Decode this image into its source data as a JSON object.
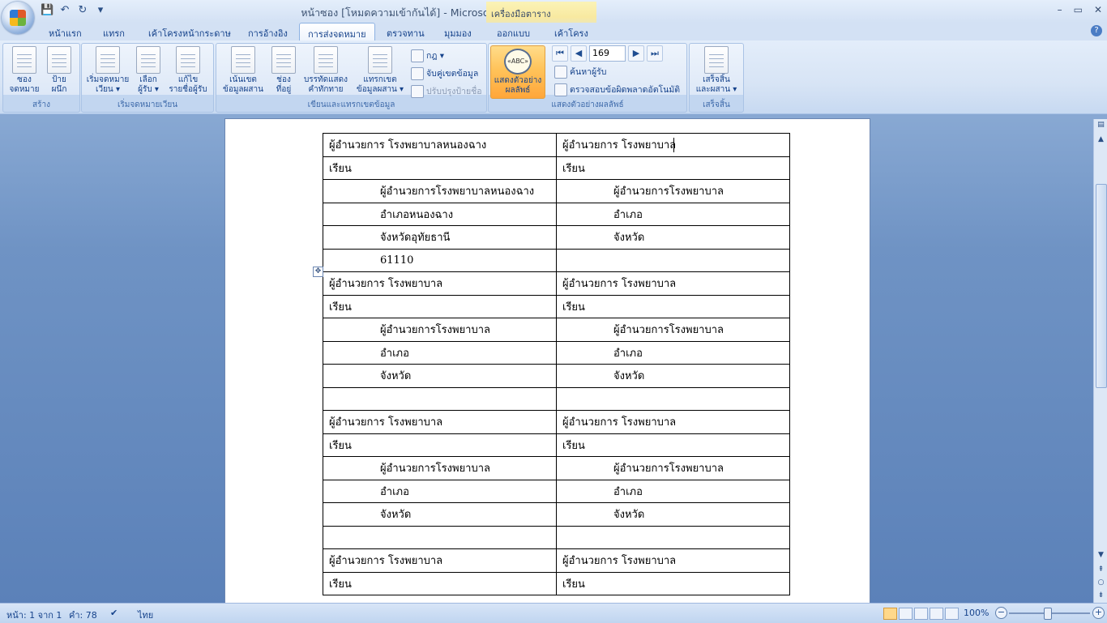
{
  "window": {
    "title": "หน้าซอง [โหมดความเข้ากันได้] - Microsoft Word",
    "context_tab": "เครื่องมือตาราง",
    "controls": [
      "–",
      "▭",
      "✕"
    ]
  },
  "qat": {
    "icons": [
      "save-icon",
      "undo-icon",
      "redo-icon",
      "customize-icon"
    ]
  },
  "tabs": [
    "หน้าแรก",
    "แทรก",
    "เค้าโครงหน้ากระดาษ",
    "การอ้างอิง",
    "การส่งจดหมาย",
    "ตรวจทาน",
    "มุมมอง",
    "ออกแบบ",
    "เค้าโครง"
  ],
  "active_tab": "การส่งจดหมาย",
  "ribbon": {
    "groups": [
      {
        "label": "สร้าง"
      },
      {
        "label": "เริ่มจดหมายเวียน"
      },
      {
        "label": "เขียนและแทรกเขตข้อมูล"
      },
      {
        "label": "แสดงตัวอย่างผลลัพธ์"
      },
      {
        "label": "เสร็จสิ้น"
      }
    ],
    "create": {
      "envelopes_1": "ซอง",
      "envelopes_2": "จดหมาย",
      "labels_1": "ป้าย",
      "labels_2": "ผนึก"
    },
    "start": {
      "start_merge_1": "เริ่มจดหมาย",
      "start_merge_2": "เวียน ▾",
      "select_1": "เลือก",
      "select_2": "ผู้รับ ▾",
      "edit_1": "แก้ไข",
      "edit_2": "รายชื่อผู้รับ"
    },
    "write": {
      "highlight_1": "เน้นเขต",
      "highlight_2": "ข้อมูลผสาน",
      "address_1": "ช่อง",
      "address_2": "ที่อยู่",
      "greeting_1": "บรรทัดแสดง",
      "greeting_2": "คำทักทาย",
      "insert_1": "แทรกเขต",
      "insert_2": "ข้อมูลผสาน ▾",
      "rules": "กฎ ▾",
      "match": "จับคู่เขตข้อมูล",
      "update": "ปรับปรุงป้ายชื่อ"
    },
    "preview": {
      "preview_1": "แสดงตัวอย่าง",
      "preview_2": "ผลลัพธ์",
      "record": "169",
      "find": "ค้นหาผู้รับ",
      "check": "ตรวจสอบข้อผิดพลาดอัตโนมัติ"
    },
    "finish": {
      "finish_1": "เสร็จสิ้น",
      "finish_2": "และผสาน ▾"
    }
  },
  "document": {
    "rows": [
      {
        "left": "ผู้อำนวยการ โรงพยาบาลหนองฉาง",
        "right": "ผู้อำนวยการ โรงพยาบาล",
        "indent": false
      },
      {
        "left": "เรียน",
        "right": "เรียน",
        "indent": false
      },
      {
        "left": "ผู้อำนวยการโรงพยาบาลหนองฉาง",
        "right": "ผู้อำนวยการโรงพยาบาล",
        "indent": true
      },
      {
        "left": "อำเภอหนองฉาง",
        "right": "อำเภอ",
        "indent": true
      },
      {
        "left": "จังหวัดอุทัยธานี",
        "right": "จังหวัด",
        "indent": true
      },
      {
        "left": "61110",
        "right": "",
        "indent": true
      },
      {
        "left": "ผู้อำนวยการ โรงพยาบาล",
        "right": "ผู้อำนวยการ โรงพยาบาล",
        "indent": false
      },
      {
        "left": "เรียน",
        "right": "เรียน",
        "indent": false
      },
      {
        "left": "ผู้อำนวยการโรงพยาบาล",
        "right": "ผู้อำนวยการโรงพยาบาล",
        "indent": true
      },
      {
        "left": "อำเภอ",
        "right": "อำเภอ",
        "indent": true
      },
      {
        "left": "จังหวัด",
        "right": "จังหวัด",
        "indent": true
      },
      {
        "left": "",
        "right": "",
        "indent": true
      },
      {
        "left": "ผู้อำนวยการ โรงพยาบาล",
        "right": "ผู้อำนวยการ โรงพยาบาล",
        "indent": false
      },
      {
        "left": "เรียน",
        "right": "เรียน",
        "indent": false
      },
      {
        "left": "ผู้อำนวยการโรงพยาบาล",
        "right": "ผู้อำนวยการโรงพยาบาล",
        "indent": true
      },
      {
        "left": "อำเภอ",
        "right": "อำเภอ",
        "indent": true
      },
      {
        "left": "จังหวัด",
        "right": "จังหวัด",
        "indent": true
      },
      {
        "left": "",
        "right": "",
        "indent": true
      },
      {
        "left": "ผู้อำนวยการ โรงพยาบาล",
        "right": "ผู้อำนวยการ โรงพยาบาล",
        "indent": false
      },
      {
        "left": "เรียน",
        "right": "เรียน",
        "indent": false
      }
    ]
  },
  "status": {
    "page": "หน้า: 1 จาก 1",
    "words": "คำ: 78",
    "language": "ไทย",
    "zoom": "100%"
  },
  "colors": {
    "accent": "#15428b",
    "ribbon": "#dde8f7",
    "preview_active": "#ffc35a"
  }
}
